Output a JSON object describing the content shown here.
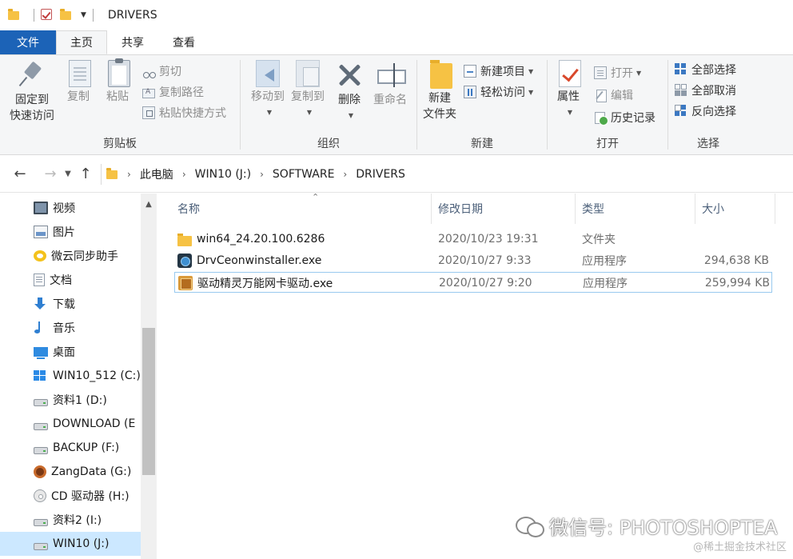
{
  "window": {
    "title": "DRIVERS"
  },
  "ribbon_tabs": [
    {
      "label": "文件"
    },
    {
      "label": "主页"
    },
    {
      "label": "共享"
    },
    {
      "label": "查看"
    }
  ],
  "ribbon": {
    "clipboard": {
      "label": "剪贴板",
      "pin_line1": "固定到",
      "pin_line2": "快速访问",
      "copy": "复制",
      "paste": "粘贴",
      "cut": "剪切",
      "copy_path": "复制路径",
      "paste_shortcut": "粘贴快捷方式"
    },
    "organize": {
      "label": "组织",
      "move_to": "移动到",
      "copy_to": "复制到",
      "delete": "删除",
      "rename": "重命名"
    },
    "new": {
      "label": "新建",
      "new_folder_line1": "新建",
      "new_folder_line2": "文件夹",
      "new_item": "新建项目",
      "easy_access": "轻松访问"
    },
    "open": {
      "label": "打开",
      "properties": "属性",
      "open": "打开",
      "edit": "编辑",
      "history": "历史记录"
    },
    "select": {
      "label": "选择",
      "select_all": "全部选择",
      "select_none": "全部取消",
      "invert": "反向选择"
    }
  },
  "address": {
    "crumbs": [
      "此电脑",
      "WIN10 (J:)",
      "SOFTWARE",
      "DRIVERS"
    ]
  },
  "sidebar": {
    "items": [
      {
        "label": "视频"
      },
      {
        "label": "图片"
      },
      {
        "label": "微云同步助手"
      },
      {
        "label": "文档"
      },
      {
        "label": "下载"
      },
      {
        "label": "音乐"
      },
      {
        "label": "桌面"
      },
      {
        "label": "WIN10_512 (C:)"
      },
      {
        "label": "资料1 (D:)"
      },
      {
        "label": "DOWNLOAD (E"
      },
      {
        "label": "BACKUP (F:)"
      },
      {
        "label": "ZangData (G:)"
      },
      {
        "label": "CD 驱动器 (H:)"
      },
      {
        "label": "资料2 (I:)"
      },
      {
        "label": "WIN10 (J:)"
      }
    ]
  },
  "columns": {
    "name": "名称",
    "date": "修改日期",
    "type": "类型",
    "size": "大小"
  },
  "files": [
    {
      "name": "win64_24.20.100.6286",
      "date": "2020/10/23 19:31",
      "type": "文件夹",
      "size": ""
    },
    {
      "name": "DrvCeonwinstaller.exe",
      "date": "2020/10/27 9:33",
      "type": "应用程序",
      "size": "294,638 KB"
    },
    {
      "name": "驱动精灵万能网卡驱动.exe",
      "date": "2020/10/27 9:20",
      "type": "应用程序",
      "size": "259,994 KB"
    }
  ],
  "watermark": {
    "main": "微信号: PHOTOSHOPTEA",
    "sub": "@稀土掘金技术社区"
  }
}
